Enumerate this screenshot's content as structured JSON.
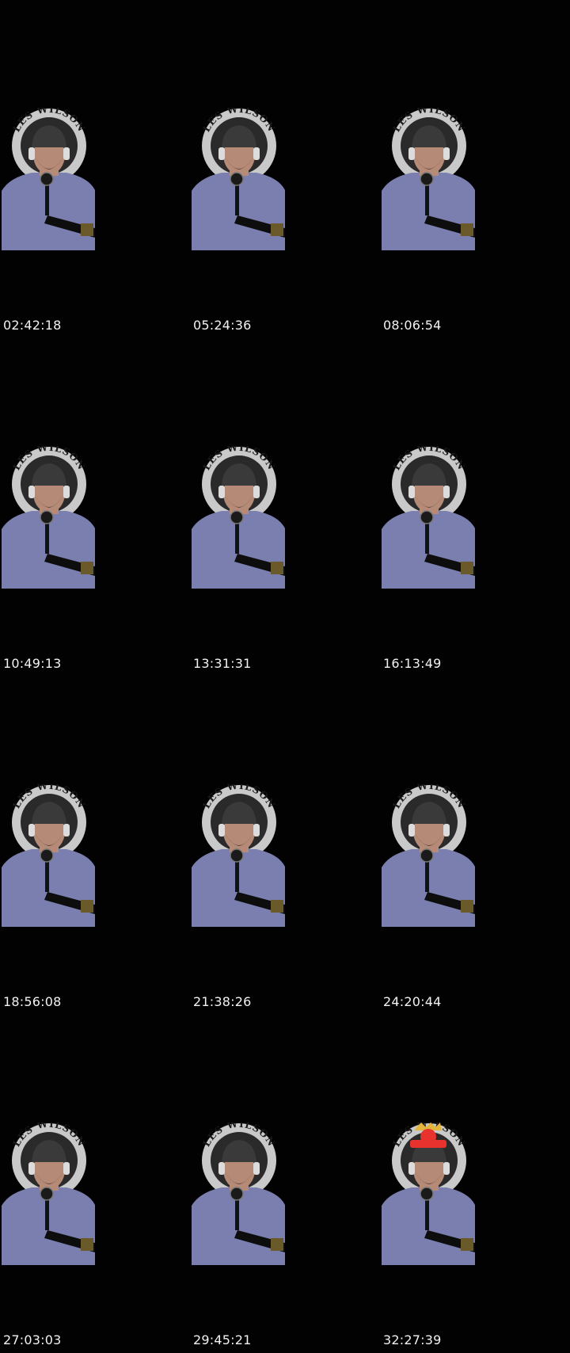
{
  "sheet": {
    "frames": [
      {
        "timestamp": "02:42:18",
        "badge_text": "LES WILSON",
        "overlay": null
      },
      {
        "timestamp": "05:24:36",
        "badge_text": "LES WILSON",
        "overlay": null
      },
      {
        "timestamp": "08:06:54",
        "badge_text": "LES WILSON",
        "overlay": null
      },
      {
        "timestamp": "10:49:13",
        "badge_text": "LES WILSON",
        "overlay": null
      },
      {
        "timestamp": "13:31:31",
        "badge_text": "LES WILSON",
        "overlay": null
      },
      {
        "timestamp": "16:13:49",
        "badge_text": "LES WILSON",
        "overlay": null
      },
      {
        "timestamp": "18:56:08",
        "badge_text": "LES WILSON",
        "overlay": null
      },
      {
        "timestamp": "21:38:26",
        "badge_text": "LES WILSON",
        "overlay": null
      },
      {
        "timestamp": "24:20:44",
        "badge_text": "LES WILSON",
        "overlay": null
      },
      {
        "timestamp": "27:03:03",
        "badge_text": "LES WILSON",
        "overlay": null
      },
      {
        "timestamp": "29:45:21",
        "badge_text": "LES WILSON",
        "overlay": null
      },
      {
        "timestamp": "32:27:39",
        "badge_text": "LES WILSON",
        "overlay": "red-crown-sticker"
      }
    ],
    "colors": {
      "background": "#020202",
      "timestamp": "#f2f2f2",
      "badge_ring": "#c9c9c9",
      "badge_inner": "#2a2a2a",
      "hoodie": "#7b7fb0",
      "skin": "#b58a76",
      "beanie": "#3a3a3a",
      "sticker": "#e8322e"
    }
  }
}
